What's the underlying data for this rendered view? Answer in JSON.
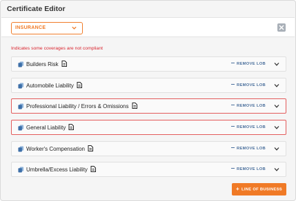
{
  "panel": {
    "title": "Certificate Editor"
  },
  "toolbar": {
    "coverage_type": "INSURANCE"
  },
  "warning": "Indicates some coverages are not compliant",
  "lobs": [
    {
      "label": "Builders Risk",
      "noncompliant": false,
      "remove_label": "REMOVE LOB"
    },
    {
      "label": "Automobile Liability",
      "noncompliant": false,
      "remove_label": "REMOVE LOB"
    },
    {
      "label": "Professional Liability / Errors & Omissions",
      "noncompliant": true,
      "remove_label": "REMOVE LOB"
    },
    {
      "label": "General Liability",
      "noncompliant": true,
      "remove_label": "REMOVE LOB"
    },
    {
      "label": "Worker's Compensation",
      "noncompliant": false,
      "remove_label": "REMOVE LOB"
    },
    {
      "label": "Umbrella/Excess Liability",
      "noncompliant": false,
      "remove_label": "REMOVE LOB"
    }
  ],
  "add_button": {
    "label": "LINE OF BUSINESS",
    "icon": "+"
  },
  "colors": {
    "accent": "#f07a26",
    "error": "#d9252f",
    "link": "#4a6f9c"
  }
}
